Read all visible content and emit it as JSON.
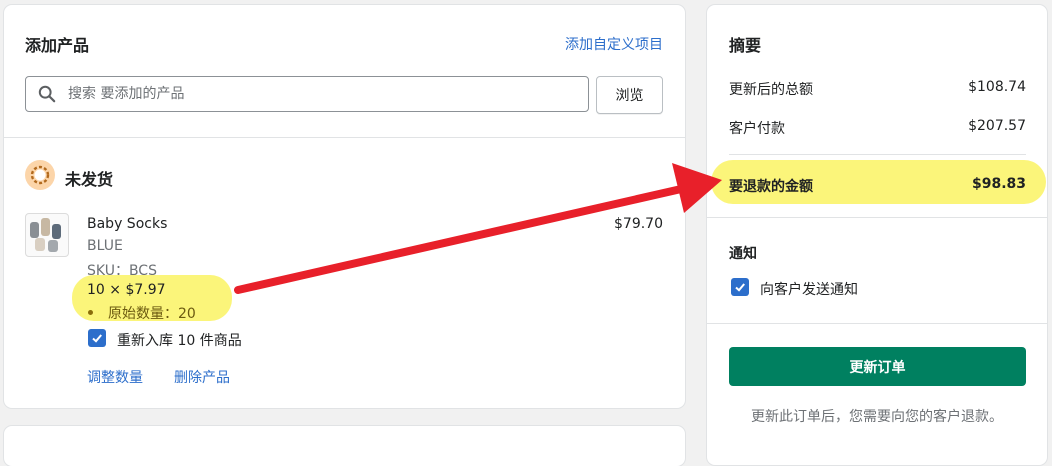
{
  "add_product": {
    "title": "添加产品",
    "custom_link": "添加自定义项目",
    "search_placeholder": "搜索 要添加的产品",
    "browse_label": "浏览"
  },
  "unfulfilled": {
    "title": "未发货",
    "product": {
      "name": "Baby Socks",
      "variant": "BLUE",
      "sku": "SKU：BCS",
      "price": "$79.70",
      "qty_line": "10 × $7.97",
      "original_qty": "原始数量：20"
    },
    "restock_label": "重新入库 10 件商品",
    "restock_checked": true,
    "adjust_link": "调整数量",
    "remove_link": "删除产品"
  },
  "summary": {
    "title": "摘要",
    "rows": [
      {
        "label": "更新后的总额",
        "value": "$108.74"
      },
      {
        "label": "客户付款",
        "value": "$207.57"
      }
    ],
    "refund": {
      "label": "要退款的金额",
      "value": "$98.83"
    },
    "notify_title": "通知",
    "notify_label": "向客户发送通知",
    "notify_checked": true,
    "update_button": "更新订单",
    "footnote": "更新此订单后，您需要向您的客户退款。"
  },
  "colors": {
    "primary_button": "#008060",
    "link": "#2c6ecb",
    "highlight": "#fbf57a",
    "annotation_arrow": "#e8202a"
  }
}
